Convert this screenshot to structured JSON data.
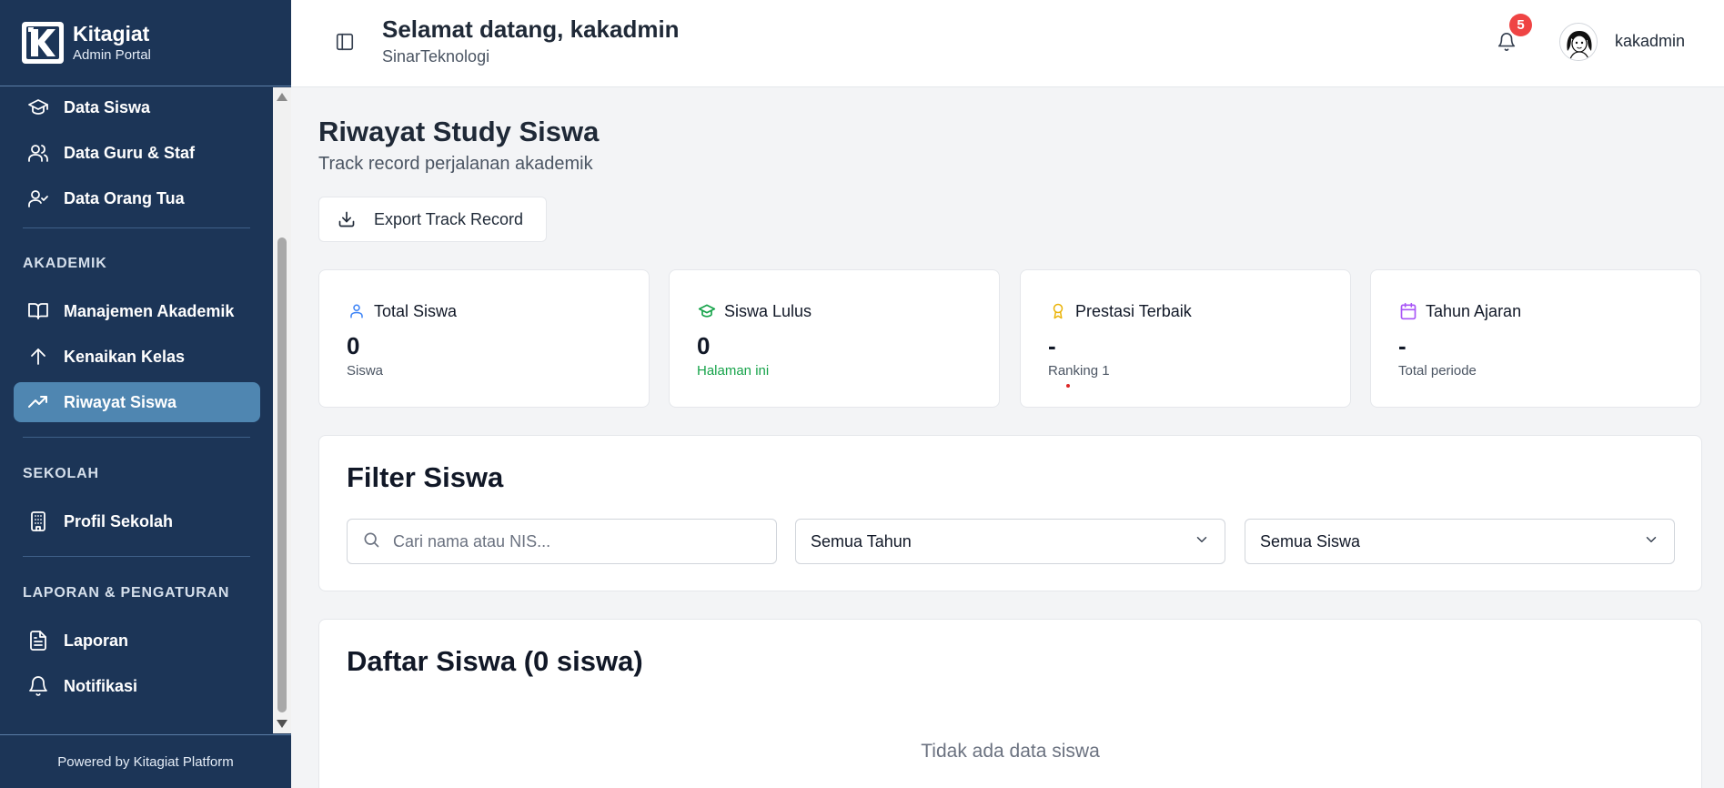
{
  "brand": {
    "name": "Kitagiat",
    "subtitle": "Admin Portal"
  },
  "sidebar": {
    "items_top": [
      {
        "label": "Data Siswa",
        "icon": "graduation-cap-icon"
      },
      {
        "label": "Data Guru & Staf",
        "icon": "users-icon"
      },
      {
        "label": "Data Orang Tua",
        "icon": "user-check-icon"
      }
    ],
    "sections": [
      {
        "label": "AKADEMIK",
        "items": [
          {
            "label": "Manajemen Akademik",
            "icon": "book-open-icon"
          },
          {
            "label": "Kenaikan Kelas",
            "icon": "arrow-up-icon"
          },
          {
            "label": "Riwayat Siswa",
            "icon": "trending-up-icon",
            "active": true
          }
        ]
      },
      {
        "label": "SEKOLAH",
        "items": [
          {
            "label": "Profil Sekolah",
            "icon": "building-icon"
          }
        ]
      },
      {
        "label": "LAPORAN & PENGATURAN",
        "items": [
          {
            "label": "Laporan",
            "icon": "file-text-icon"
          },
          {
            "label": "Notifikasi",
            "icon": "bell-icon"
          }
        ]
      }
    ],
    "footer": "Powered by Kitagiat Platform"
  },
  "header": {
    "welcome": "Selamat datang, kakadmin",
    "school": "SinarTeknologi",
    "notification_count": "5",
    "username": "kakadmin"
  },
  "page": {
    "title": "Riwayat Study Siswa",
    "subtitle": "Track record perjalanan akademik",
    "export_label": "Export Track Record"
  },
  "stats": [
    {
      "title": "Total Siswa",
      "value": "0",
      "note": "Siswa",
      "icon": "user-icon",
      "color": "#3b82f6"
    },
    {
      "title": "Siswa Lulus",
      "value": "0",
      "note": "Halaman ini",
      "icon": "graduation-cap-icon",
      "color": "#16a34a"
    },
    {
      "title": "Prestasi Terbaik",
      "value": "-",
      "note": "Ranking 1",
      "icon": "award-icon",
      "color": "#eab308"
    },
    {
      "title": "Tahun Ajaran",
      "value": "-",
      "note": "Total periode",
      "icon": "calendar-icon",
      "color": "#a855f7"
    }
  ],
  "filter": {
    "title": "Filter Siswa",
    "search_placeholder": "Cari nama atau NIS...",
    "year_select": "Semua Tahun",
    "student_select": "Semua Siswa"
  },
  "list": {
    "title": "Daftar Siswa (0 siswa)",
    "empty": "Tidak ada data siswa"
  },
  "colors": {
    "sidebar_bg": "#1c3557",
    "active_item": "#4f86b1",
    "badge": "#ef4444"
  }
}
